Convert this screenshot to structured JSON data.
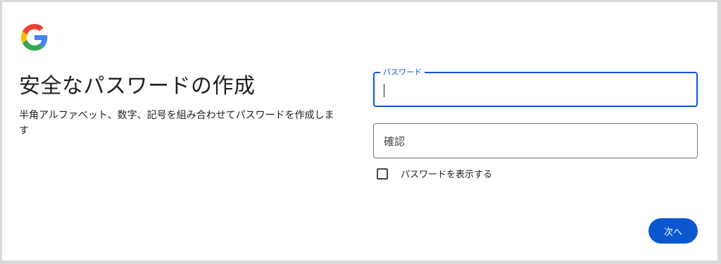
{
  "header": {
    "logo_icon": "google-g-logo-icon"
  },
  "main": {
    "title": "安全なパスワードの作成",
    "subtitle": "半角アルファベット、数字、記号を組み合わせてパスワードを作成します"
  },
  "form": {
    "password": {
      "label": "パスワード",
      "value": ""
    },
    "confirm": {
      "placeholder": "確認",
      "value": ""
    },
    "show_password": {
      "label": "パスワードを表示する",
      "checked": false
    },
    "next_label": "次へ"
  },
  "colors": {
    "accent": "#0b57d0",
    "text": "#1f1f1f",
    "border": "#747775"
  }
}
